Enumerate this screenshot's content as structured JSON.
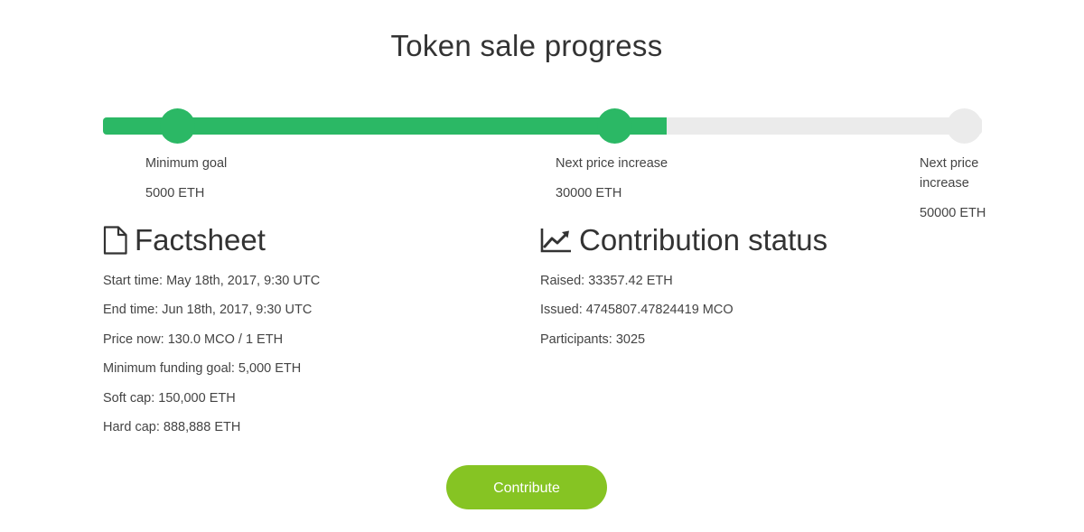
{
  "title": "Token sale progress",
  "progress": {
    "fraction": 0.641,
    "colors": {
      "fill": "#2bb865",
      "track": "#ebebeb"
    },
    "milestones": [
      {
        "label": "Minimum goal",
        "value": "5000 ETH",
        "reached": true
      },
      {
        "label": "Next price increase",
        "value": "30000 ETH",
        "reached": true
      },
      {
        "label": "Next price increase",
        "value": "50000 ETH",
        "reached": false
      }
    ]
  },
  "factsheet": {
    "icon": "document-icon",
    "heading": "Factsheet",
    "items": [
      "Start time: May 18th, 2017, 9:30 UTC",
      "End time: Jun 18th, 2017, 9:30 UTC",
      "Price now: 130.0 MCO / 1 ETH",
      "Minimum funding goal: 5,000 ETH",
      "Soft cap: 150,000 ETH",
      "Hard cap: 888,888 ETH"
    ]
  },
  "contribution": {
    "icon": "line-chart-icon",
    "heading": "Contribution status",
    "items": [
      "Raised: 33357.42 ETH",
      "Issued: 4745807.47824419 MCO",
      "Participants: 3025"
    ]
  },
  "contribute_button": {
    "label": "Contribute",
    "color": "#86c423"
  }
}
